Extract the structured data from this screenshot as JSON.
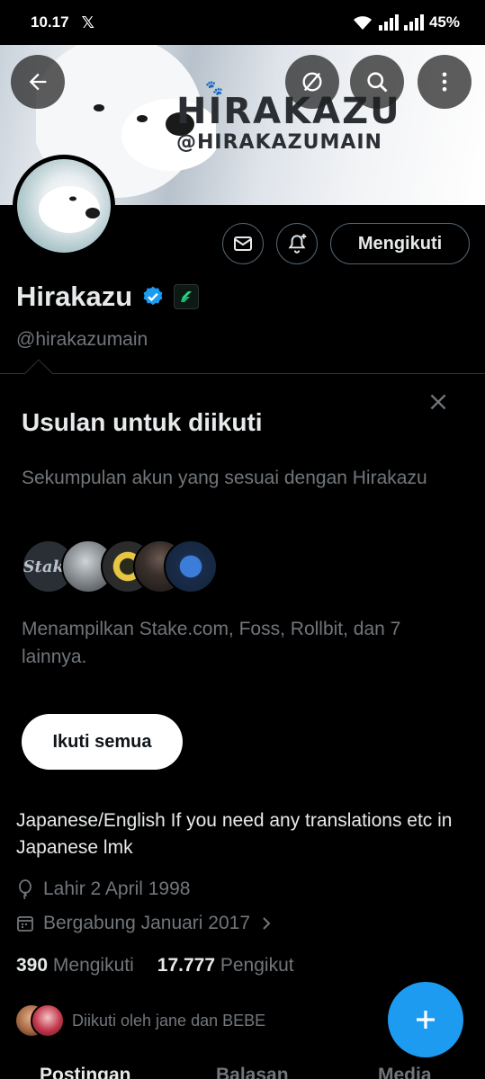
{
  "status_bar": {
    "time": "10.17",
    "app_icon": "x-logo",
    "battery": "45%"
  },
  "banner": {
    "brand_name": "HIRAKAZU",
    "brand_handle": "@HIRAKAZUMAIN"
  },
  "header_buttons": {
    "back_icon": "arrow-left-icon",
    "grok_icon": "slashed-circle-icon",
    "search_icon": "search-icon",
    "more_icon": "more-vertical-icon"
  },
  "profile": {
    "name": "Hirakazu",
    "handle": "@hirakazumain",
    "verified": true,
    "follow_button": "Mengikuti",
    "bio": "Japanese/English If you need any translations etc in Japanese lmk",
    "birth": "Lahir 2 April 1998",
    "joined": "Bergabung Januari 2017",
    "following_count": "390",
    "following_label": "Mengikuti",
    "followers_count": "17.777",
    "followers_label": "Pengikut",
    "followed_by": "Diikuti oleh jane dan BEBE"
  },
  "suggestions": {
    "title": "Usulan untuk diikuti",
    "subtitle": "Sekumpulan akun yang sesuai dengan Hirakazu",
    "note": "Menampilkan Stake.com, Foss, Rollbit, dan 7 lainnya.",
    "follow_all": "Ikuti semua",
    "stake_logo_text": "Stake"
  },
  "tabs": [
    "Postingan",
    "Balasan",
    "Media"
  ],
  "colors": {
    "accent": "#1d9bf0",
    "muted": "#71767b",
    "text": "#e7e9ea",
    "background": "#000000"
  }
}
